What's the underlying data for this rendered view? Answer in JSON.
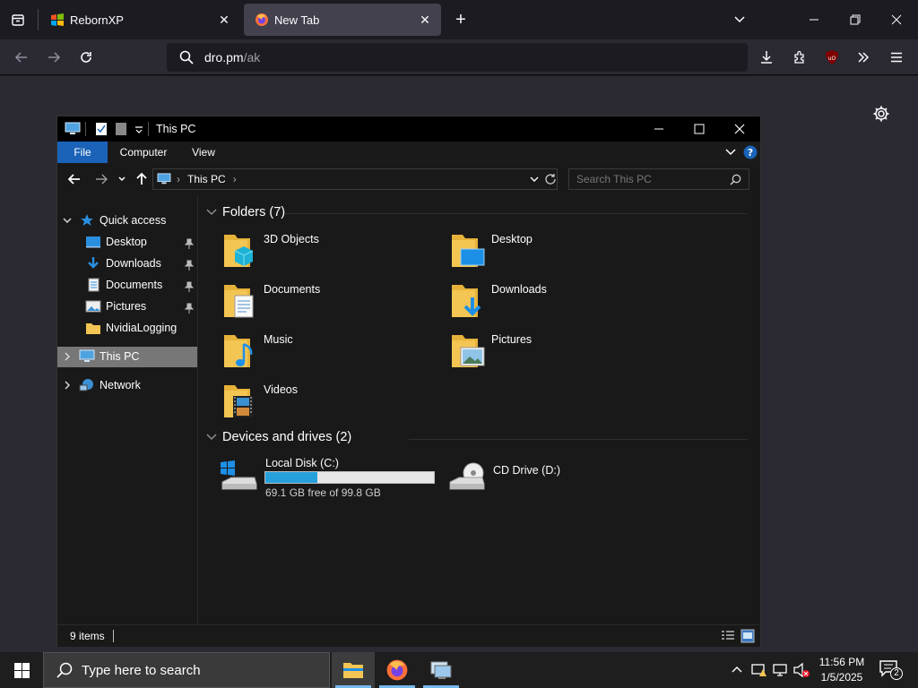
{
  "browser": {
    "tabs": [
      {
        "title": "RebornXP",
        "active": false
      },
      {
        "title": "New Tab",
        "active": true
      }
    ],
    "url_domain": "dro.pm",
    "url_path": "/ak"
  },
  "explorer": {
    "title": "This PC",
    "ribbon_tabs": [
      "File",
      "Computer",
      "View"
    ],
    "address": "This PC",
    "search_placeholder": "Search This PC",
    "nav": {
      "quick_access": "Quick access",
      "items": [
        "Desktop",
        "Downloads",
        "Documents",
        "Pictures",
        "NvidiaLogging"
      ],
      "this_pc": "This PC",
      "network": "Network"
    },
    "folders_header": "Folders (7)",
    "folders": [
      "3D Objects",
      "Desktop",
      "Documents",
      "Downloads",
      "Music",
      "Pictures",
      "Videos"
    ],
    "drives_header": "Devices and drives (2)",
    "drives": [
      {
        "name": "Local Disk (C:)",
        "free_text": "69.1 GB free of 99.8 GB",
        "used_fraction": 0.308
      },
      {
        "name": "CD Drive (D:)"
      }
    ],
    "status": "9 items"
  },
  "taskbar": {
    "search_placeholder": "Type here to search",
    "time": "11:56 PM",
    "date": "1/5/2025",
    "notifications": "2"
  },
  "colors": {
    "accent": "#1a63b8",
    "folder": "#f3c552",
    "drive_bar": "#26a0da"
  }
}
